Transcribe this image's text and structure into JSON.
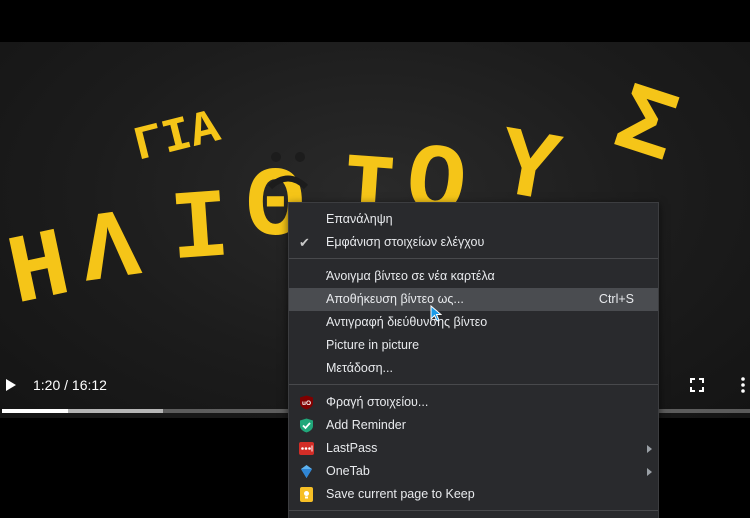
{
  "video": {
    "title_art_small": "ΓΙΑ",
    "title_art_large": "ΗΛΙΘΙΟΥΣ",
    "colors": {
      "text": "#f5c518",
      "background": "#1c1c1c"
    }
  },
  "controls": {
    "play_icon": "play-icon",
    "time": "1:20 / 16:12",
    "fullscreen_icon": "fullscreen-icon",
    "more_icon": "more-vert-icon",
    "progress": {
      "played_fraction": 0.088,
      "buffered_fraction": 0.215
    }
  },
  "context_menu": {
    "items": [
      {
        "label": "Επανάληψη"
      },
      {
        "label": "Εμφάνιση στοιχείων ελέγχου",
        "checked": true,
        "check_glyph": "✔"
      },
      {
        "label": "Άνοιγμα βίντεο σε νέα καρτέλα"
      },
      {
        "label": "Αποθήκευση βίντεο ως...",
        "shortcut": "Ctrl+S",
        "highlighted": true
      },
      {
        "label": "Αντιγραφή διεύθυνσης βίντεο"
      },
      {
        "label": "Picture in picture"
      },
      {
        "label": "Μετάδοση..."
      },
      {
        "label": "Φραγή στοιχείου...",
        "icon": "ublock-icon",
        "icon_text": "uO",
        "icon_color": "#800000"
      },
      {
        "label": "Add Reminder",
        "icon": "reminder-check-icon",
        "icon_color": "#21a77a"
      },
      {
        "label": "LastPass",
        "icon": "lastpass-icon",
        "icon_color": "#d32d27",
        "submenu": true
      },
      {
        "label": "OneTab",
        "icon": "onetab-icon",
        "icon_color": "#5db2f0",
        "submenu": true
      },
      {
        "label": "Save current page to Keep",
        "icon": "keep-icon",
        "icon_color": "#f6bf26"
      }
    ]
  }
}
